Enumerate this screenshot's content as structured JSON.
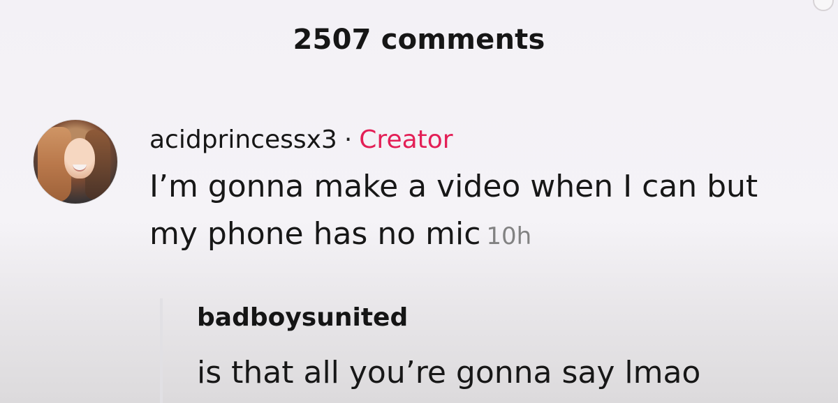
{
  "header": {
    "comments_count_label": "2507 comments"
  },
  "comment": {
    "username": "acidprincessx3",
    "separator": "·",
    "badge": "Creator",
    "text": "I’m gonna make a video when I can but my phone has no mic",
    "timestamp": "10h"
  },
  "reply": {
    "username": "badboysunited",
    "text": "is that all you’re gonna say lmao"
  },
  "colors": {
    "creator_badge": "#e31f56",
    "timestamp": "#828282",
    "text": "#161616"
  }
}
